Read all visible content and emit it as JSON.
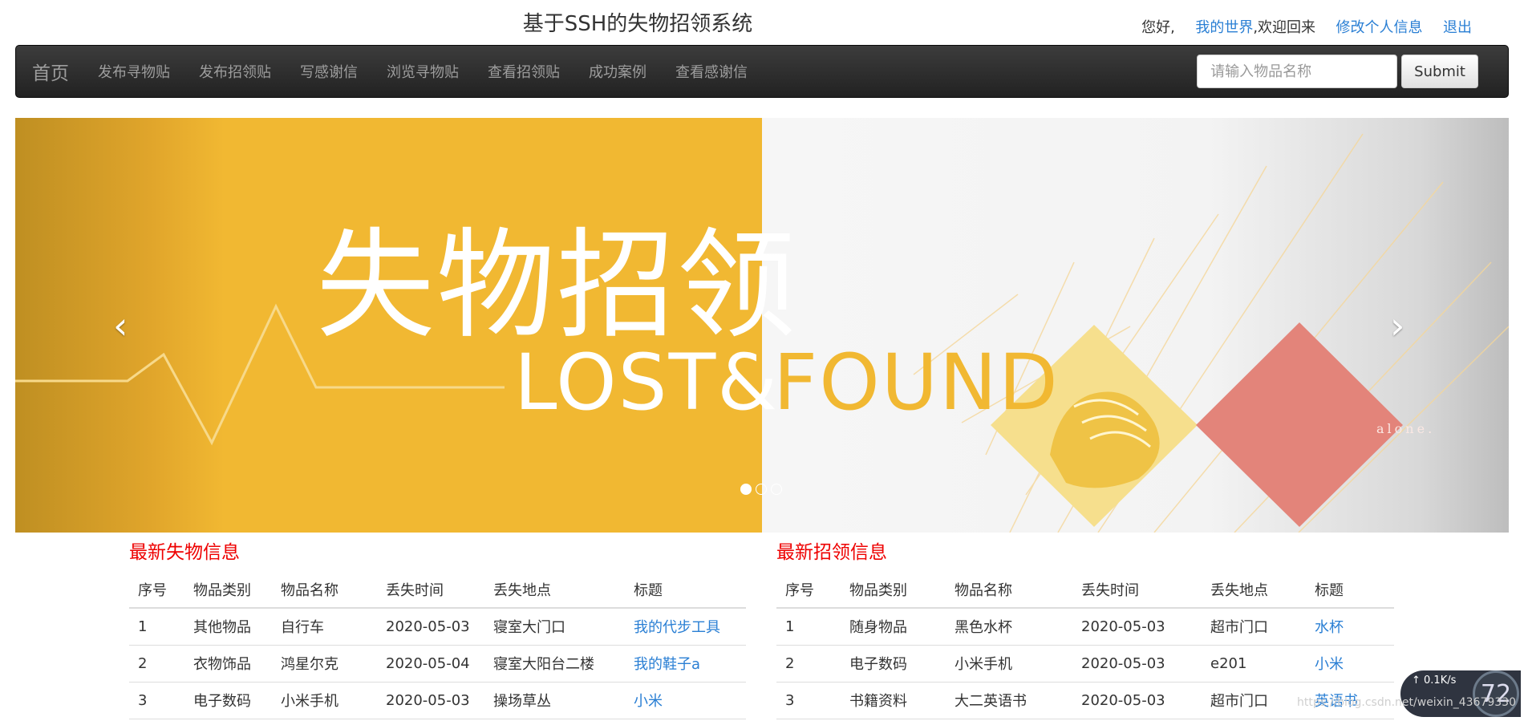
{
  "header": {
    "site_title": "基于SSH的失物招领系统",
    "greeting": "您好,",
    "username": "我的世界",
    "welcome": ",欢迎回来",
    "edit_profile": "修改个人信息",
    "logout": "退出"
  },
  "navbar": {
    "brand": "首页",
    "items": [
      {
        "label": "发布寻物贴"
      },
      {
        "label": "发布招领贴"
      },
      {
        "label": "写感谢信"
      },
      {
        "label": "浏览寻物贴"
      },
      {
        "label": "查看招领贴"
      },
      {
        "label": "成功案例"
      },
      {
        "label": "查看感谢信"
      }
    ],
    "search_placeholder": "请输入物品名称",
    "submit_label": "Submit"
  },
  "carousel": {
    "banner_cn": "失物招领",
    "banner_en_left": "LOST&",
    "banner_en_right": "FOUND",
    "alone_text": "alone.",
    "prev_icon": "‹",
    "next_icon": "›",
    "slide_count": 3,
    "active_index": 0
  },
  "lost": {
    "title": "最新失物信息",
    "headers": [
      "序号",
      "物品类别",
      "物品名称",
      "丢失时间",
      "丢失地点",
      "标题"
    ],
    "rows": [
      {
        "no": "1",
        "category": "其他物品",
        "name": "自行车",
        "date": "2020-05-03",
        "place": "寝室大门口",
        "title": "我的代步工具"
      },
      {
        "no": "2",
        "category": "衣物饰品",
        "name": "鸿星尔克",
        "date": "2020-05-04",
        "place": "寝室大阳台二楼",
        "title": "我的鞋子a"
      },
      {
        "no": "3",
        "category": "电子数码",
        "name": "小米手机",
        "date": "2020-05-03",
        "place": "操场草丛",
        "title": "小米"
      }
    ]
  },
  "found": {
    "title": "最新招领信息",
    "headers": [
      "序号",
      "物品类别",
      "物品名称",
      "丢失时间",
      "丢失地点",
      "标题"
    ],
    "rows": [
      {
        "no": "1",
        "category": "随身物品",
        "name": "黑色水杯",
        "date": "2020-05-03",
        "place": "超市门口",
        "title": "水杯"
      },
      {
        "no": "2",
        "category": "电子数码",
        "name": "小米手机",
        "date": "2020-05-03",
        "place": "e201",
        "title": "小米"
      },
      {
        "no": "3",
        "category": "书籍资料",
        "name": "大二英语书",
        "date": "2020-05-03",
        "place": "超市门口",
        "title": "英语书"
      }
    ]
  },
  "widget": {
    "upload_speed": "0.1K/s",
    "percent": "72"
  },
  "watermark": "https://blog.csdn.net/weixin_43679330"
}
